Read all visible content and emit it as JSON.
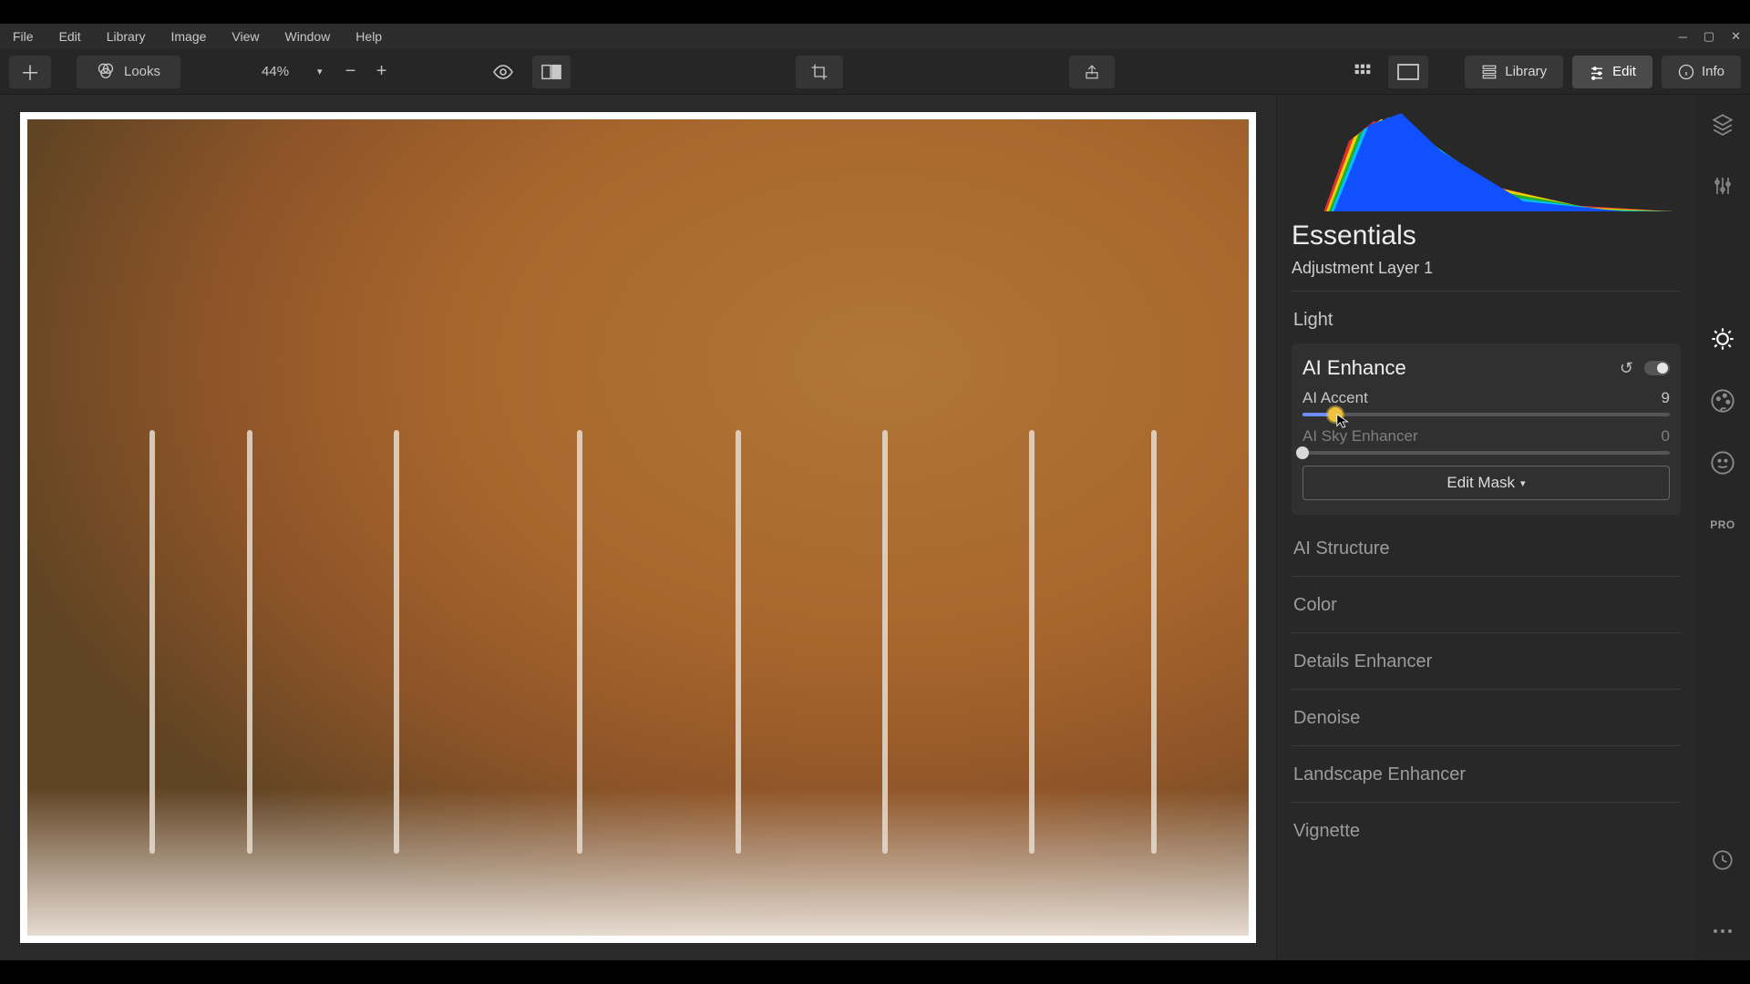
{
  "menu": [
    "File",
    "Edit",
    "Library",
    "Image",
    "View",
    "Window",
    "Help"
  ],
  "toolbar": {
    "looks_label": "Looks",
    "zoom_label": "44%"
  },
  "mode_tabs": {
    "library": "Library",
    "edit": "Edit",
    "info": "Info",
    "active": "edit"
  },
  "panel": {
    "title": "Essentials",
    "layer": "Adjustment Layer 1",
    "light_label": "Light",
    "ai_enhance": {
      "title": "AI Enhance",
      "accent_label": "AI Accent",
      "accent_value": "9",
      "accent_pos_pct": 9,
      "sky_label": "AI Sky Enhancer",
      "sky_value": "0",
      "sky_pos_pct": 0,
      "edit_mask_label": "Edit Mask"
    },
    "groups": [
      "AI Structure",
      "Color",
      "Details Enhancer",
      "Denoise",
      "Landscape Enhancer",
      "Vignette"
    ]
  },
  "rail_right": {
    "pro_label": "PRO"
  }
}
